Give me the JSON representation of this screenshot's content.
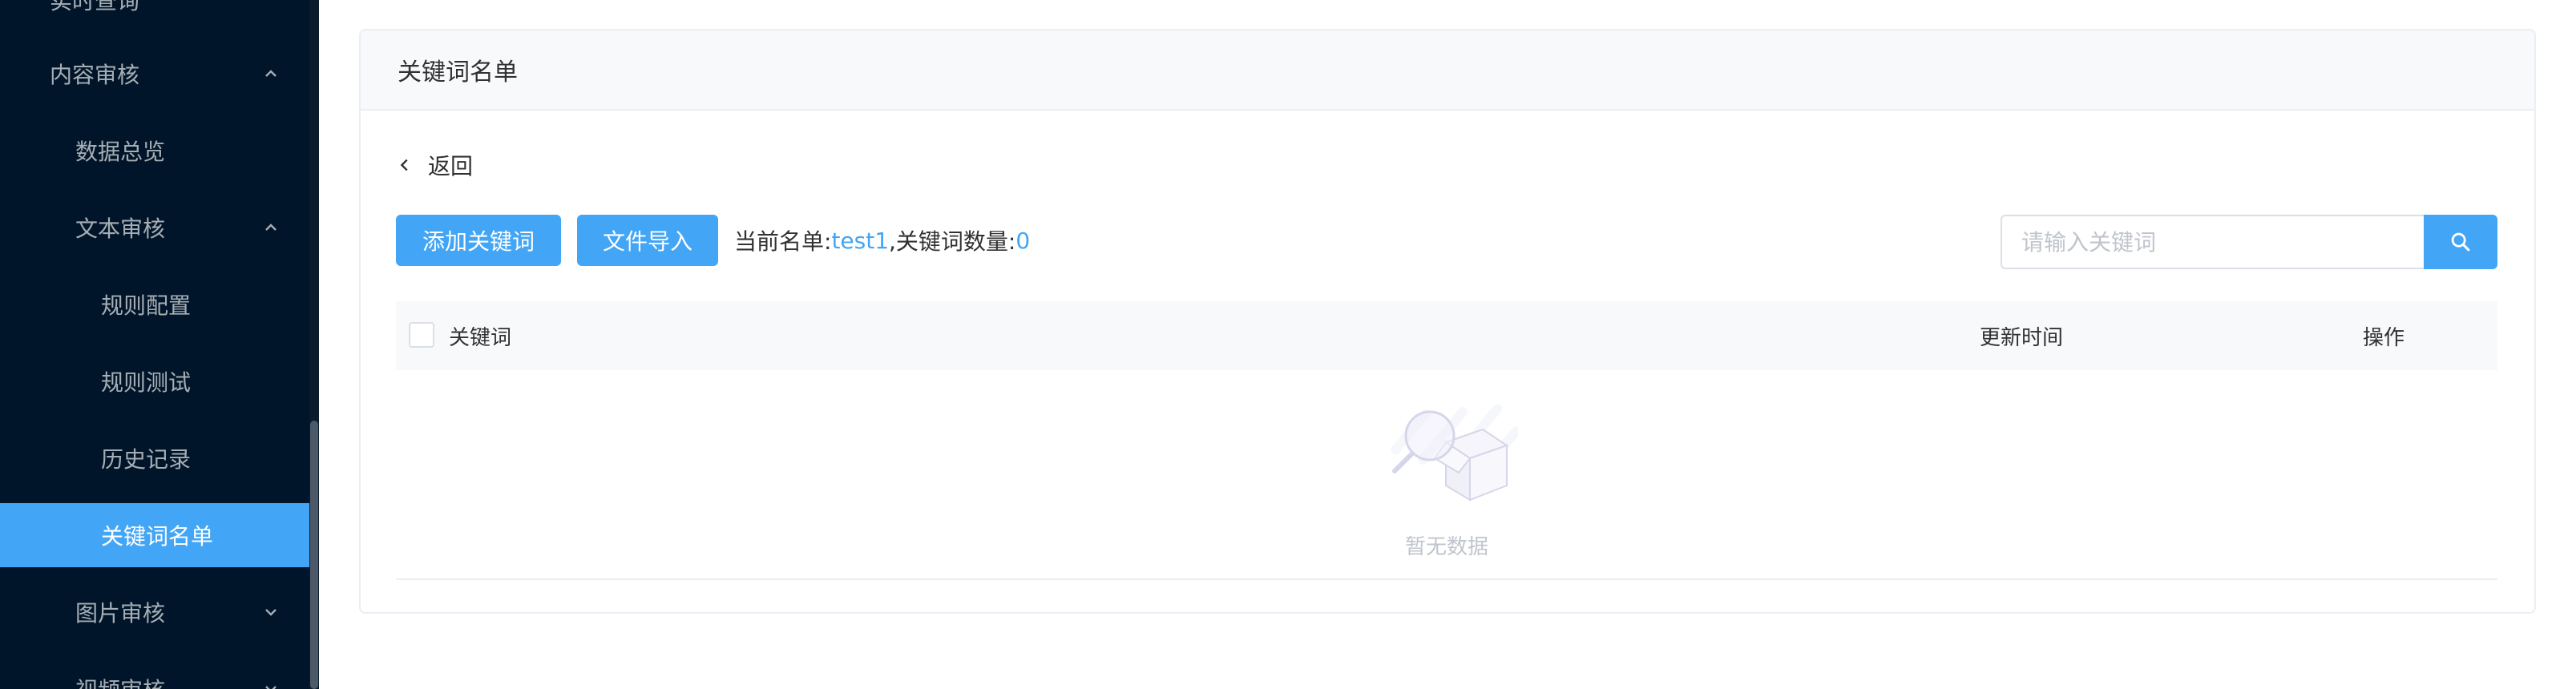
{
  "sidebar": {
    "items": [
      {
        "label": "实时查询",
        "level": 1,
        "chevron": "none"
      },
      {
        "label": "内容审核",
        "level": 1,
        "chevron": "up"
      },
      {
        "label": "数据总览",
        "level": 2,
        "chevron": "none"
      },
      {
        "label": "文本审核",
        "level": 2,
        "chevron": "up"
      },
      {
        "label": "规则配置",
        "level": 3,
        "chevron": "none"
      },
      {
        "label": "规则测试",
        "level": 3,
        "chevron": "none"
      },
      {
        "label": "历史记录",
        "level": 3,
        "chevron": "none"
      },
      {
        "label": "关键词名单",
        "level": 3,
        "chevron": "none",
        "active": true
      },
      {
        "label": "图片审核",
        "level": 2,
        "chevron": "down"
      },
      {
        "label": "视频审核",
        "level": 2,
        "chevron": "down"
      }
    ],
    "active_color": "#42a5f5",
    "background_color": "#001529"
  },
  "card": {
    "title": "关键词名单"
  },
  "toolbar": {
    "back_label": "返回",
    "add_label": "添加关键词",
    "import_label": "文件导入",
    "current_list_prefix": "当前名单: ",
    "current_list_name": "test1",
    "keyword_count_prefix": ",关键词数量: ",
    "keyword_count": "0"
  },
  "search": {
    "placeholder": "请输入关键词",
    "value": ""
  },
  "table": {
    "columns": [
      "关键词",
      "更新时间",
      "操作"
    ],
    "rows": [],
    "empty_text": "暂无数据"
  },
  "colors": {
    "primary": "#42a5f5",
    "text": "#303133",
    "muted": "#c0c4cc"
  }
}
